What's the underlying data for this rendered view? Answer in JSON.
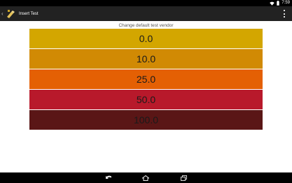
{
  "status_bar": {
    "time": "7:59"
  },
  "action_bar": {
    "title": "Insert Test"
  },
  "content": {
    "section_label": "Change default test vendor",
    "options": [
      {
        "label": "0.0",
        "color": "#d3a600"
      },
      {
        "label": "10.0",
        "color": "#d18a04"
      },
      {
        "label": "25.0",
        "color": "#e46004"
      },
      {
        "label": "50.0",
        "color": "#b8192b"
      },
      {
        "label": "100.0",
        "color": "#5a1616"
      }
    ]
  },
  "icons": {
    "wifi": "wifi-icon",
    "battery": "battery-icon",
    "back": "back-icon",
    "home": "home-icon",
    "recents": "recents-icon",
    "overflow": "overflow-menu-icon"
  }
}
